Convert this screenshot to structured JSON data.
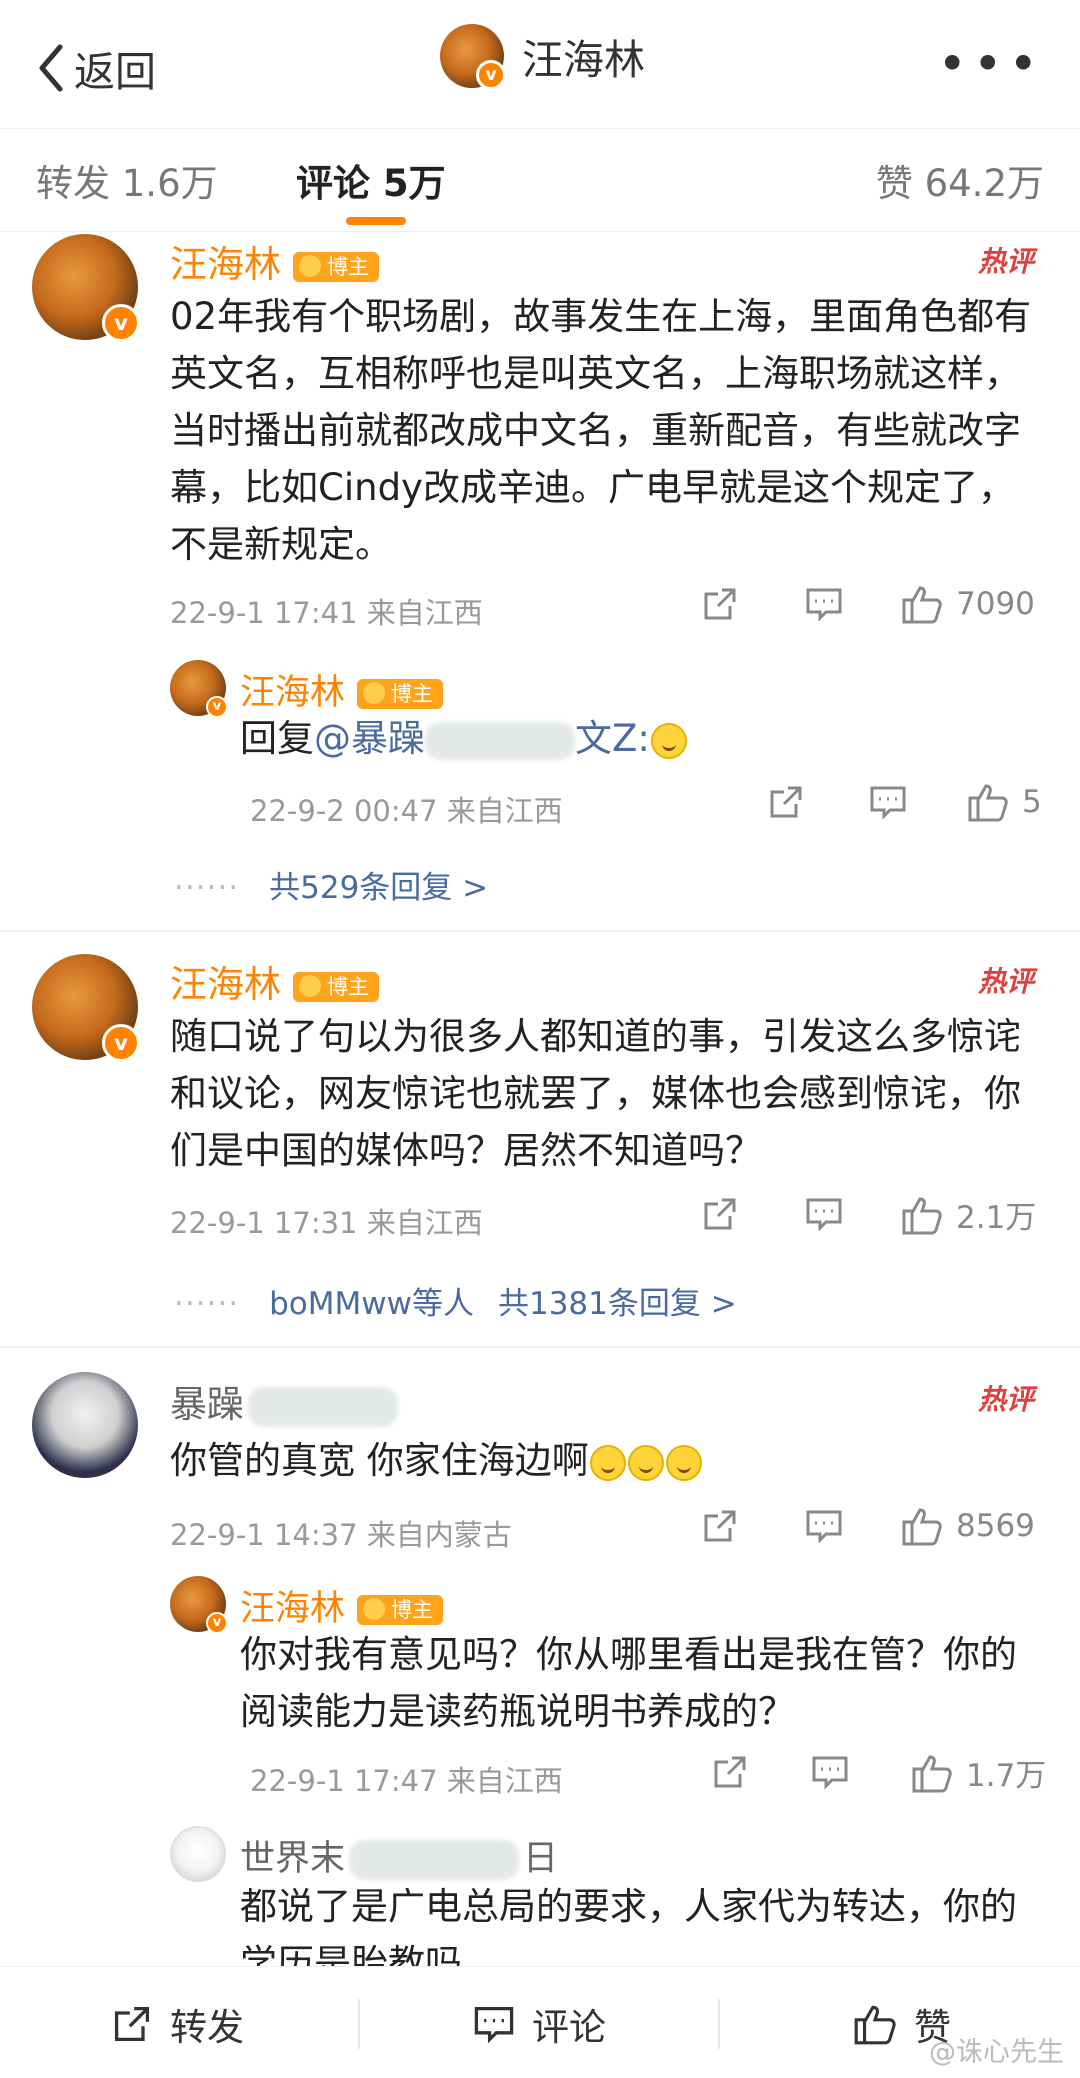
{
  "header": {
    "back_label": "返回",
    "title": "汪海林",
    "more": "•••"
  },
  "tabs": {
    "repost": "转发 1.6万",
    "comment": "评论 5万",
    "like": "赞 64.2万"
  },
  "badge_label": "博主",
  "hot_label": "热评",
  "comments": [
    {
      "name": "汪海林",
      "text": "02年我有个职场剧，故事发生在上海，里面角色都有英文名，互相称呼也是叫英文名，上海职场就这样，当时播出前就都改成中文名，重新配音，有些就改字幕，比如Cindy改成辛迪。广电早就是这个规定了，不是新规定。",
      "time": "22-9-1 17:41 来自江西",
      "likes": "7090",
      "reply": {
        "name": "汪海林",
        "prefix": "回复",
        "mention": "@暴躁",
        "mention_tail": "文Z:",
        "time": "22-9-2 00:47 来自江西",
        "likes": "5"
      },
      "replies_link": "共529条回复 >"
    },
    {
      "name": "汪海林",
      "text": "随口说了句以为很多人都知道的事，引发这么多惊诧和议论，网友惊诧也就罢了，媒体也会感到惊诧，你们是中国的媒体吗？居然不知道吗？",
      "time": "22-9-1 17:31 来自江西",
      "likes": "2.1万",
      "replies_prefix": "boMMww等人",
      "replies_link": "共1381条回复 >"
    },
    {
      "name": "暴躁",
      "text": "你管的真宽  你家住海边啊",
      "time": "22-9-1 14:37 来自内蒙古",
      "likes": "8569",
      "reply": {
        "name": "汪海林",
        "text": "你对我有意见吗？你从哪里看出是我在管？你的阅读能力是读药瓶说明书养成的？",
        "time": "22-9-1 17:47 来自江西",
        "likes": "1.7万"
      },
      "reply2": {
        "name": "世界末",
        "name_tail": "日",
        "text": "都说了是广电总局的要求，人家代为转达，你的学历是胎教吗"
      }
    }
  ],
  "bottombar": {
    "repost": "转发",
    "comment": "评论",
    "like": "赞"
  },
  "watermark": "@诛心先生",
  "colors": {
    "accent": "#ff8200",
    "link": "#4a6ba0",
    "hot": "#e0413c"
  }
}
